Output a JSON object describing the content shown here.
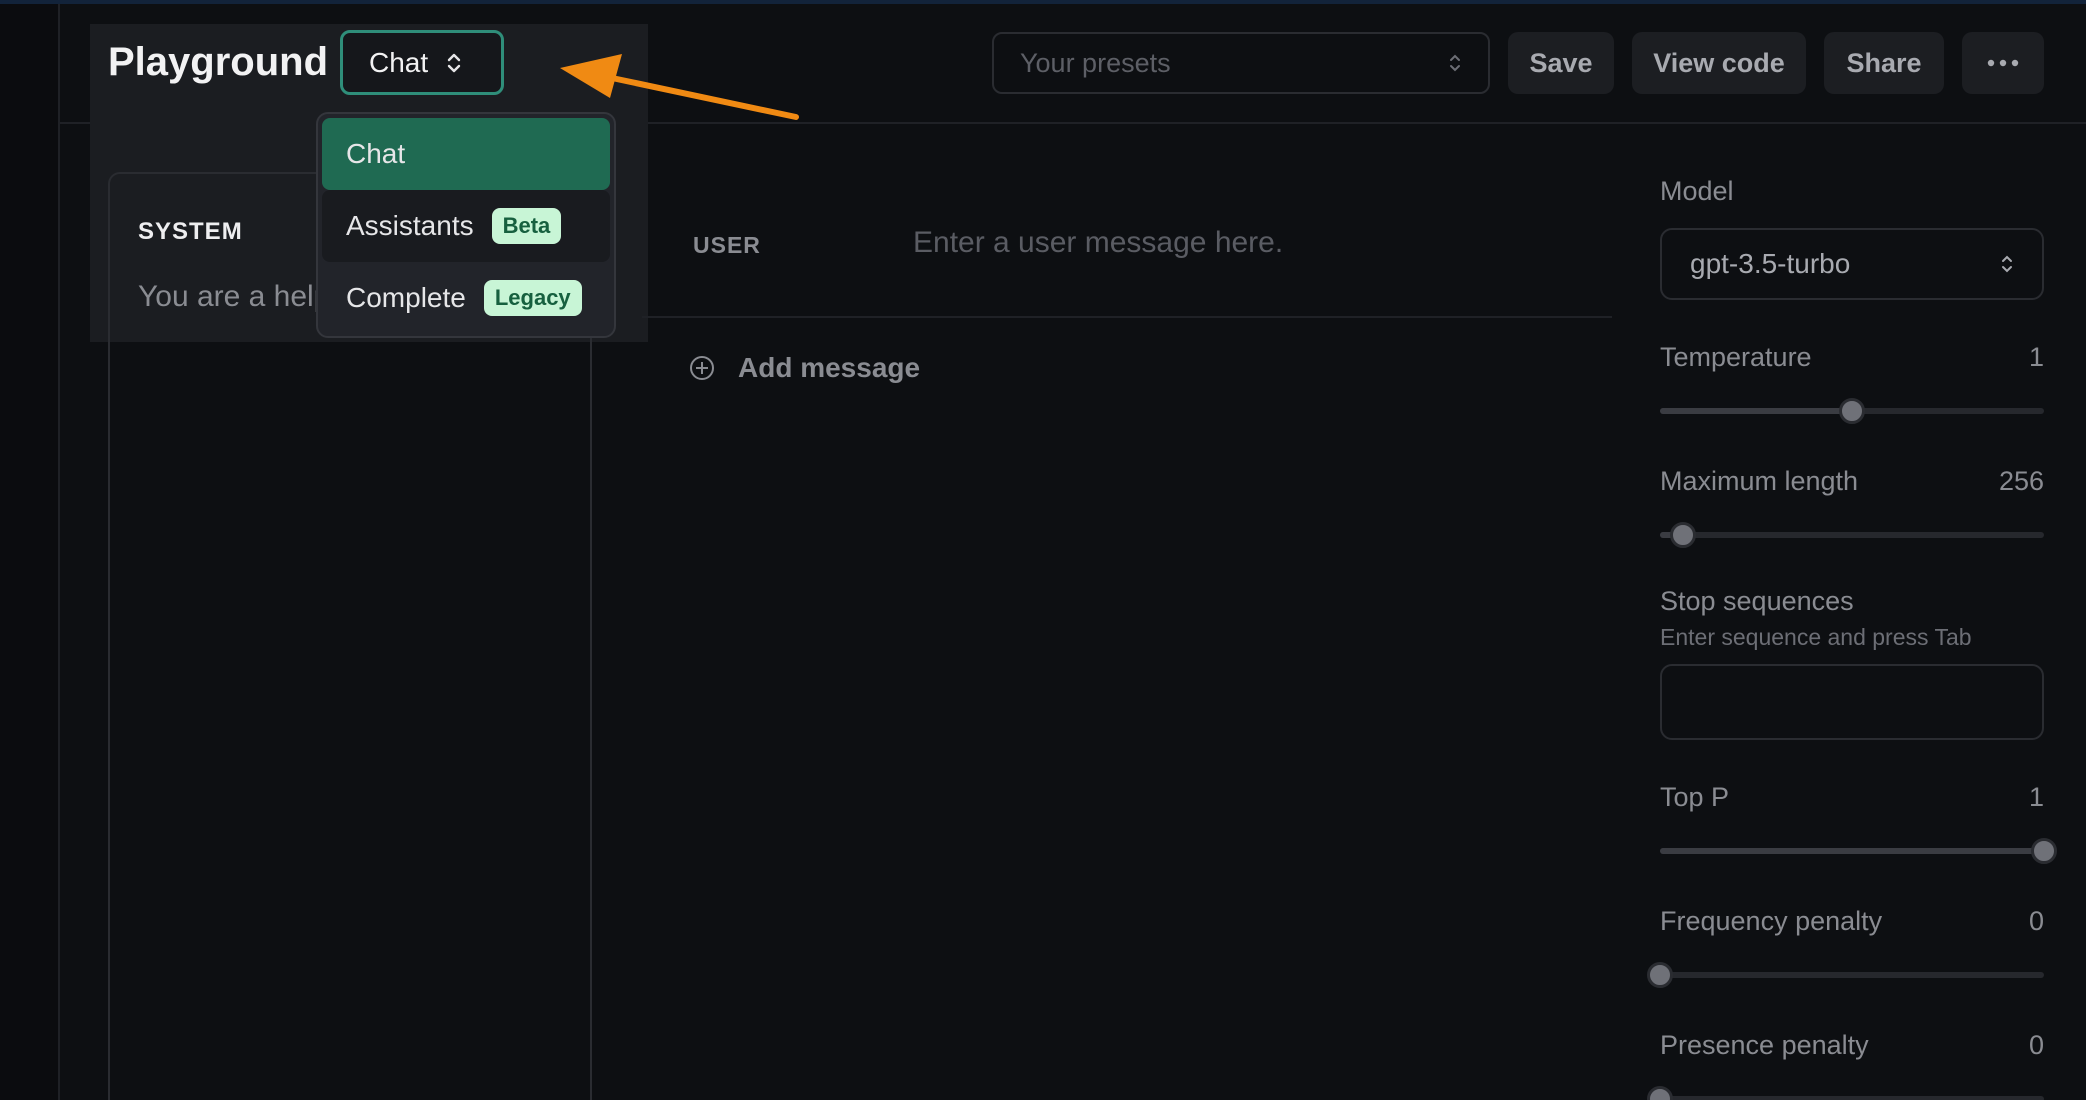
{
  "header": {
    "title": "Playground",
    "mode_label": "Chat",
    "presets_placeholder": "Your presets",
    "save_label": "Save",
    "view_code_label": "View code",
    "share_label": "Share",
    "more_label": "···"
  },
  "mode_menu": {
    "items": [
      {
        "label": "Chat",
        "badge": ""
      },
      {
        "label": "Assistants",
        "badge": "Beta"
      },
      {
        "label": "Complete",
        "badge": "Legacy"
      }
    ]
  },
  "system": {
    "label": "SYSTEM",
    "text": "You are a helpful assistant."
  },
  "chat": {
    "user_label": "USER",
    "user_placeholder": "Enter a user message here.",
    "add_message_label": "Add message"
  },
  "settings": {
    "model_label": "Model",
    "model_value": "gpt-3.5-turbo",
    "temperature": {
      "label": "Temperature",
      "value": "1",
      "fraction": 0.5
    },
    "max_length": {
      "label": "Maximum length",
      "value": "256",
      "fraction": 0.06
    },
    "stop_sequences": {
      "label": "Stop sequences",
      "hint": "Enter sequence and press Tab"
    },
    "top_p": {
      "label": "Top P",
      "value": "1",
      "fraction": 1.0
    },
    "frequency_penalty": {
      "label": "Frequency penalty",
      "value": "0",
      "fraction": 0.0
    },
    "presence_penalty": {
      "label": "Presence penalty",
      "value": "0",
      "fraction": 0.0
    }
  },
  "colors": {
    "accent": "#1f6a52",
    "focus_ring": "#2f8e7a",
    "annotation_arrow": "#f08a13"
  }
}
